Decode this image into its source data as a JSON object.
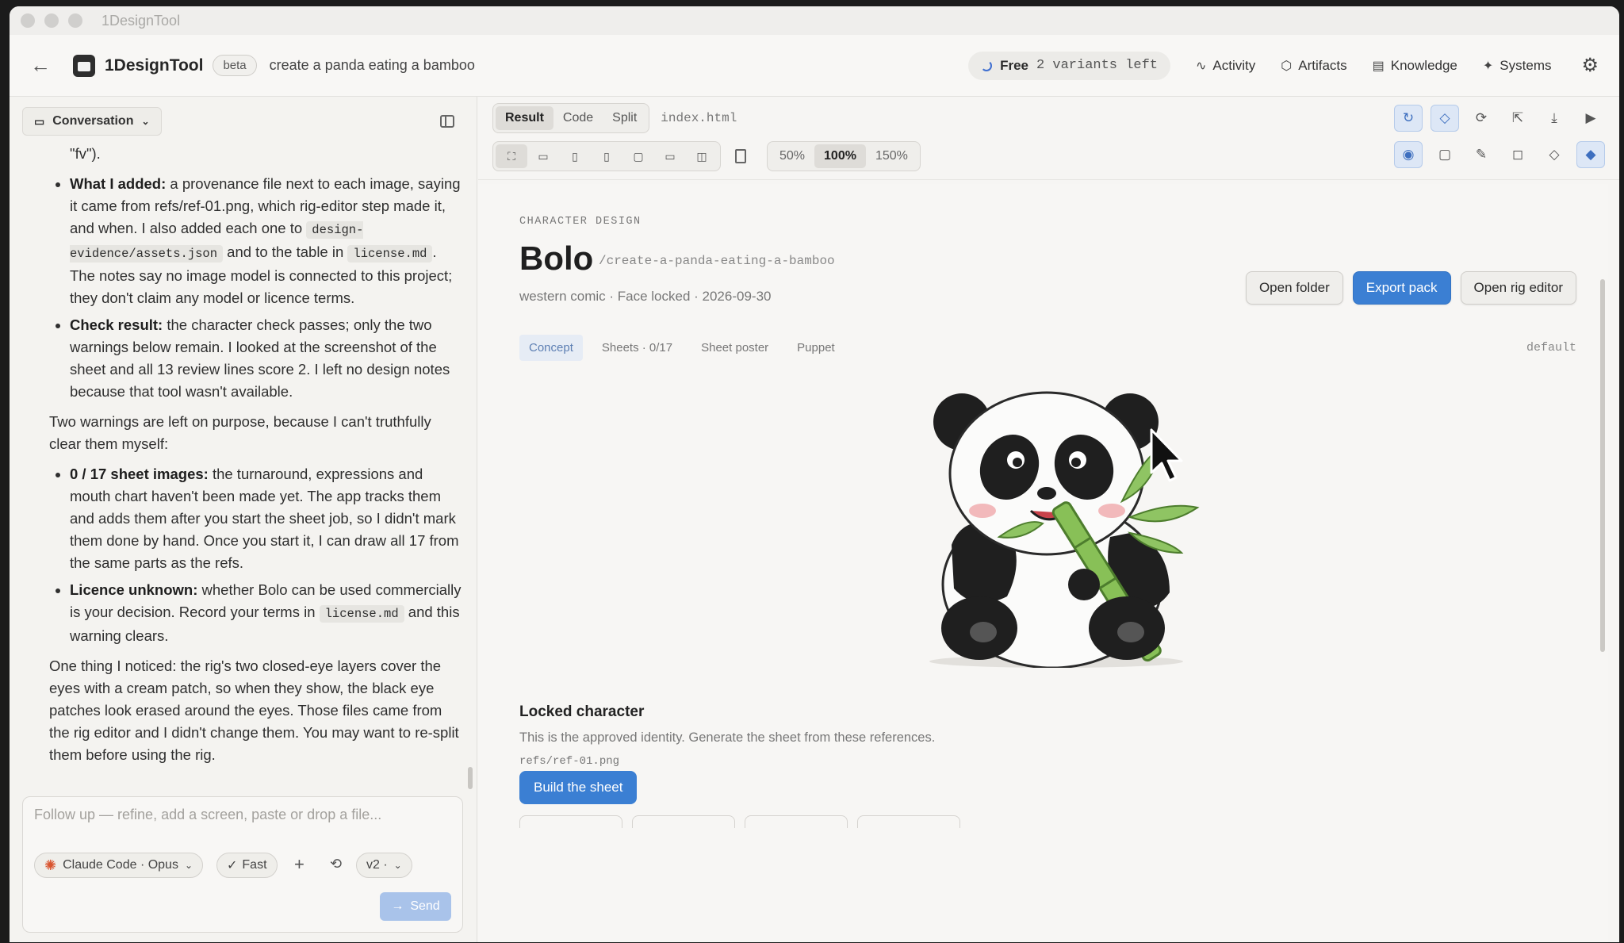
{
  "window": {
    "title": "1DesignTool"
  },
  "header": {
    "app_name": "1DesignTool",
    "beta": "beta",
    "prompt": "create a panda eating a bamboo",
    "free_label": "Free",
    "variants_left": "2 variants left",
    "nav": [
      {
        "label": "Activity",
        "icon": "activity-icon"
      },
      {
        "label": "Artifacts",
        "icon": "cube-icon"
      },
      {
        "label": "Knowledge",
        "icon": "book-icon"
      },
      {
        "label": "Systems",
        "icon": "sparkle-icon"
      }
    ]
  },
  "sidebar": {
    "mode_label": "Conversation",
    "message": {
      "top_text": "\"fv\").",
      "b1_title": "What I added:",
      "b1_a": " a provenance file next to each image, saying it came from refs/ref-01.png, which rig-editor step made it, and when. I also added each one to ",
      "b1_code1": "design-evidence/assets.json",
      "b1_b": " and to the table in ",
      "b1_code2": "license.md",
      "b1_c": ". The notes say no image model is connected to this project; they don't claim any model or licence terms.",
      "b2_title": "Check result:",
      "b2_text": " the character check passes; only the two warnings below remain. I looked at the screenshot of the sheet and all 13 review lines score 2. I left no design notes because that tool wasn't available.",
      "p_warnings": "Two warnings are left on purpose, because I can't truthfully clear them myself:",
      "b3_title": "0 / 17 sheet images:",
      "b3_text": " the turnaround, expressions and mouth chart haven't been made yet. The app tracks them and adds them after you start the sheet job, so I didn't mark them done by hand. Once you start it, I can draw all 17 from the same parts as the refs.",
      "b4_title": "Licence unknown:",
      "b4_a": " whether Bolo can be used commercially is your decision. Record your terms in ",
      "b4_code": "license.md",
      "b4_b": " and this warning clears.",
      "p_last": "One thing I noticed: the rig's two closed-eye layers cover the eyes with a cream patch, so when they show, the black eye patches look erased around the eyes. Those files came from the rig editor and I didn't change them. You may want to re-split them before using the rig."
    },
    "composer": {
      "placeholder": "Follow up — refine, add a screen, paste or drop a file...",
      "model": "Claude Code · Opus",
      "speed": "Fast",
      "version": "v2 ·",
      "send": "Send"
    }
  },
  "toolbar": {
    "view_tabs": [
      "Result",
      "Code",
      "Split"
    ],
    "active_view": "Result",
    "filename": "index.html",
    "zoom": [
      "50%",
      "100%",
      "150%"
    ],
    "active_zoom": "100%"
  },
  "preview": {
    "eyebrow": "CHARACTER DESIGN",
    "name": "Bolo",
    "slug": "/create-a-panda-eating-a-bamboo",
    "meta": "western comic · Face locked · 2026-09-30",
    "buttons": {
      "open_folder": "Open folder",
      "export_pack": "Export pack",
      "open_rig": "Open rig editor"
    },
    "tabs": [
      "Concept",
      "Sheets · 0/17",
      "Sheet poster",
      "Puppet"
    ],
    "active_tab": "Concept",
    "variant": "default",
    "locked_title": "Locked character",
    "locked_desc": "This is the approved identity. Generate the sheet from these references.",
    "ref_path": "refs/ref-01.png",
    "build_button": "Build the sheet"
  },
  "colors": {
    "accent": "#3b7fd3",
    "panda_black": "#1f1f1f",
    "bamboo": "#7fb84a"
  }
}
